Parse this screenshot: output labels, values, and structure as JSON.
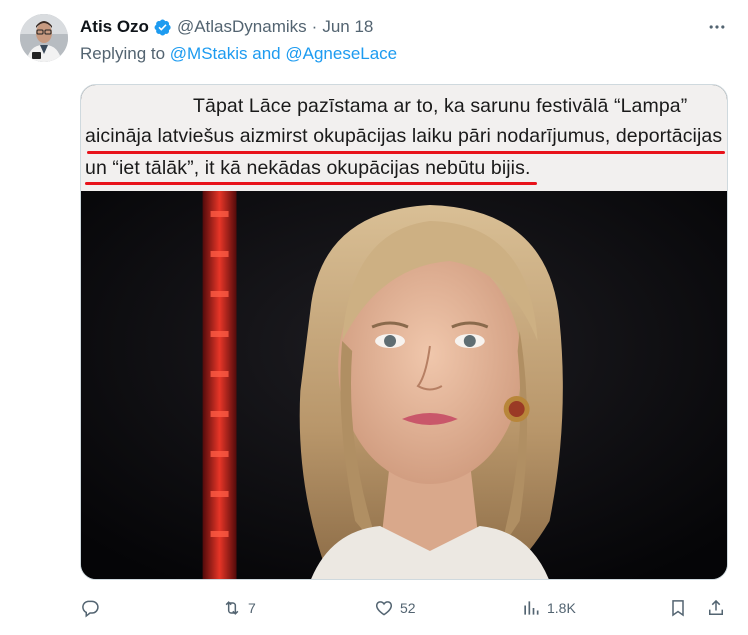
{
  "tweet": {
    "author_name": "Atis Ozo",
    "author_handle": "@AtlasDynamiks",
    "separator": "·",
    "date": "Jun 18",
    "reply_prefix": "Replying to",
    "reply_user_1": "@MStakis",
    "reply_and": "and",
    "reply_user_2": "@AgneseLace"
  },
  "image_caption": {
    "line1": "Tāpat Lāce pazīstama ar to, ka sarunu festivālā “Lampa”",
    "line2": "aicināja latviešus aizmirst okupācijas laiku pāri nodarījumus, deportācijas",
    "line3": "un “iet tālāk”, it kā nekādas okupācijas nebūtu bijis.",
    "underline_color": "#e8121a"
  },
  "actions": {
    "reply_count": "",
    "retweet_count": "7",
    "like_count": "52",
    "views_count": "1.8K"
  },
  "icons": {
    "verified": "verified-badge-icon",
    "more": "more-icon",
    "reply": "reply-icon",
    "retweet": "retweet-icon",
    "like": "heart-icon",
    "views": "views-icon",
    "bookmark": "bookmark-icon",
    "share": "share-icon"
  },
  "colors": {
    "link": "#1d9bf0",
    "secondary": "#536471",
    "primary": "#0f1419"
  }
}
